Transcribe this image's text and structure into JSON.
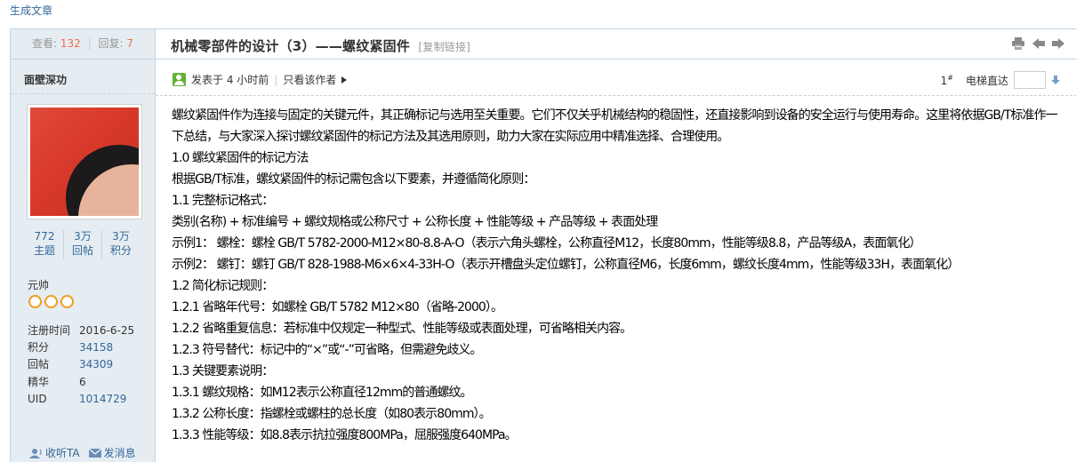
{
  "topbar": {
    "generate_article": "生成文章"
  },
  "side_head": {
    "views_label": "查看:",
    "views": "132",
    "replies_label": "回复:",
    "replies": "7"
  },
  "thread": {
    "title": "机械零部件的设计（3）——螺纹紧固件",
    "copy_link": "[复制链接]"
  },
  "icons": {
    "print": "print-icon",
    "prev": "arrow-left-icon",
    "next": "arrow-right-icon"
  },
  "author": {
    "name": "面壁深功",
    "stats": [
      {
        "value": "772",
        "label": "主题"
      },
      {
        "value": "3万",
        "label": "回帖"
      },
      {
        "value": "3万",
        "label": "积分"
      }
    ],
    "rank": "元帅",
    "stars": 3,
    "info": [
      {
        "key": "注册时间",
        "value": "2016-6-25"
      },
      {
        "key": "积分",
        "value": "34158"
      },
      {
        "key": "回帖",
        "value": "34309"
      },
      {
        "key": "精华",
        "value": "6"
      },
      {
        "key": "UID",
        "value": "1014729"
      }
    ],
    "follow": "收听TA",
    "message": "发消息"
  },
  "post_meta": {
    "posted": "发表于 4 小时前",
    "author_only": "只看该作者",
    "floor": "1",
    "floor_sup": "#",
    "elevator": "电梯直达"
  },
  "content": [
    "螺纹紧固件作为连接与固定的关键元件，其正确标记与选用至关重要。它们不仅关乎机械结构的稳固性，还直接影响到设备的安全运行与使用寿命。这里将依据GB/T标准作一下总结，与大家深入探讨螺纹紧固件的标记方法及其选用原则，助力大家在实际应用中精准选择、合理使用。",
    "1.0 螺纹紧固件的标记方法",
    "根据GB/T标准，螺纹紧固件的标记需包含以下要素，并遵循简化原则：",
    "1.1 完整标记格式：",
    "类别(名称) + 标准编号 + 螺纹规格或公称尺寸 + 公称长度 + 性能等级 + 产品等级 + 表面处理",
    "示例1：  螺栓：螺栓 GB/T 5782-2000-M12×80-8.8-A-O（表示六角头螺栓，公称直径M12，长度80mm，性能等级8.8，产品等级A，表面氧化）",
    "示例2：  螺钉：螺钉 GB/T 828-1988-M6×6×4-33H-O（表示开槽盘头定位螺钉，公称直径M6，长度6mm，螺纹长度4mm，性能等级33H，表面氧化）",
    "1.2 简化标记规则：",
    "1.2.1 省略年代号：如螺栓 GB/T 5782 M12×80（省略-2000）。",
    "1.2.2 省略重复信息：若标准中仅规定一种型式、性能等级或表面处理，可省略相关内容。",
    "1.2.3 符号替代：标记中的“×”或“-”可省略，但需避免歧义。",
    "1.3 关键要素说明：",
    "1.3.1 螺纹规格：如M12表示公称直径12mm的普通螺纹。",
    "1.3.2 公称长度：指螺栓或螺柱的总长度（如80表示80mm）。",
    "1.3.3 性能等级：如8.8表示抗拉强度800MPa，屈服强度640MPa。"
  ]
}
